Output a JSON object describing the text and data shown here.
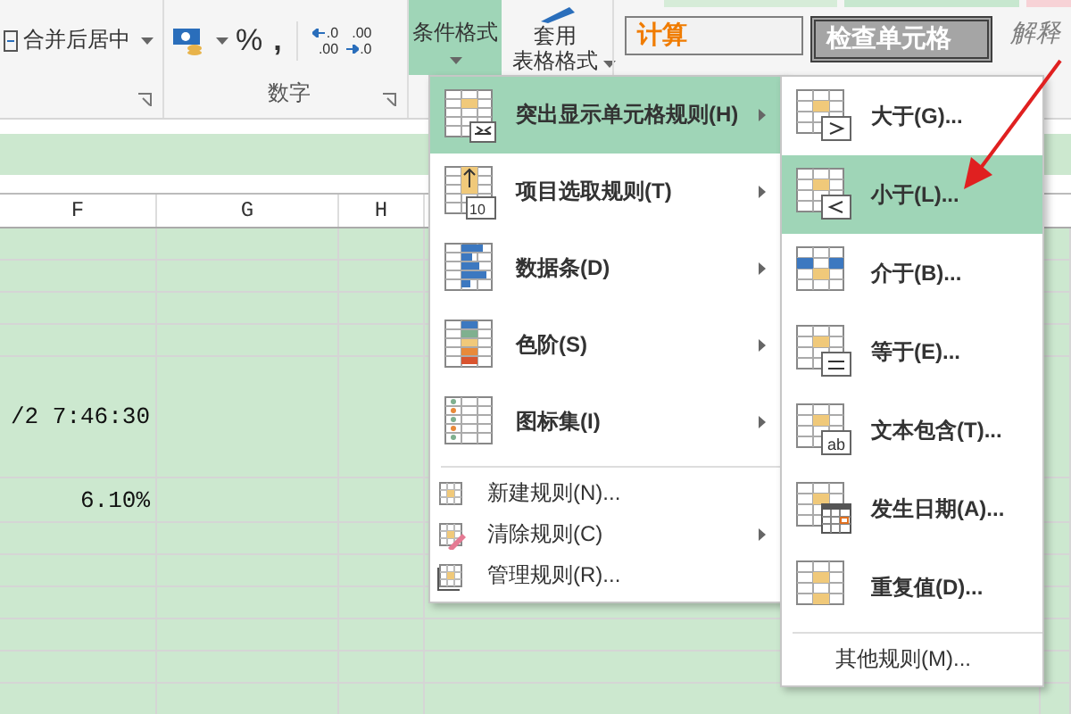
{
  "ribbon": {
    "merge_button": {
      "label": "合并后居中"
    },
    "number_group": {
      "label": "数字",
      "percent": "%",
      "comma": ",",
      "increase_decimal": [
        ".0",
        ".00"
      ],
      "decrease_decimal": [
        ".00",
        ".0"
      ]
    },
    "conditional_format_button": {
      "label": "条件格式",
      "selected": true
    },
    "table_format_button": {
      "lines": [
        "套用",
        "表格格式"
      ]
    },
    "styles": [
      {
        "text": "计算",
        "kind": "calc"
      },
      {
        "text": "检查单元格",
        "kind": "check"
      },
      {
        "text": "解释",
        "kind": "explain"
      }
    ]
  },
  "sheet": {
    "columns": [
      "F",
      "G",
      "H"
    ],
    "values": [
      {
        "text": "/2 7:46:30"
      },
      {
        "text": "6.10%"
      }
    ]
  },
  "menu": {
    "items": [
      {
        "label": "突出显示单元格规则(H)",
        "kind": "highlight",
        "selected": true,
        "submenu": true
      },
      {
        "label": "项目选取规则(T)",
        "kind": "top10",
        "badge": "10",
        "selected": false,
        "submenu": true
      },
      {
        "label": "数据条(D)",
        "kind": "databar",
        "selected": false,
        "submenu": true
      },
      {
        "label": "色阶(S)",
        "kind": "colorscale",
        "selected": false,
        "submenu": true
      },
      {
        "label": "图标集(I)",
        "kind": "iconset",
        "selected": false,
        "submenu": true
      },
      {
        "label": "新建规则(N)...",
        "kind": "new",
        "selected": false,
        "submenu": false
      },
      {
        "label": "清除规则(C)",
        "kind": "clear",
        "selected": false,
        "submenu": true
      },
      {
        "label": "管理规则(R)...",
        "kind": "manage",
        "selected": false,
        "submenu": false
      }
    ]
  },
  "submenu": {
    "items": [
      {
        "label": "大于(G)...",
        "kind": "greater",
        "selected": false
      },
      {
        "label": "小于(L)...",
        "kind": "less",
        "selected": true
      },
      {
        "label": "介于(B)...",
        "kind": "between",
        "selected": false
      },
      {
        "label": "等于(E)...",
        "kind": "equal",
        "selected": false
      },
      {
        "label": "文本包含(T)...",
        "kind": "text",
        "badge": "ab",
        "selected": false
      },
      {
        "label": "发生日期(A)...",
        "kind": "date",
        "selected": false
      },
      {
        "label": "重复值(D)...",
        "kind": "duplicate",
        "selected": false
      },
      {
        "label": "其他规则(M)...",
        "kind": "more",
        "selected": false
      }
    ]
  }
}
